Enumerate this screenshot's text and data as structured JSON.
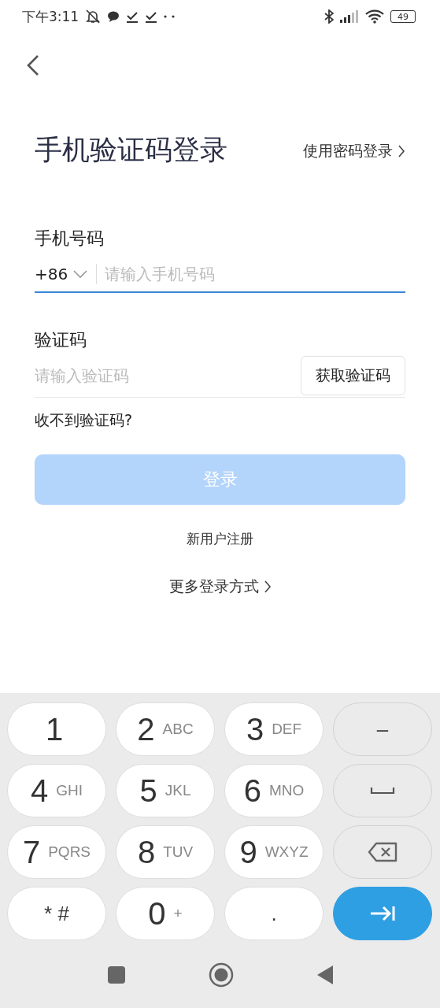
{
  "status_bar": {
    "time": "下午3:11",
    "battery": "49"
  },
  "header": {
    "title": "手机验证码登录",
    "switch_link": "使用密码登录"
  },
  "phone": {
    "label": "手机号码",
    "country_code": "+86",
    "placeholder": "请输入手机号码",
    "focused": true
  },
  "code": {
    "label": "验证码",
    "placeholder": "请输入验证码",
    "get_code_button": "获取验证码"
  },
  "help_link": "收不到验证码?",
  "login_button": {
    "label": "登录",
    "disabled": true
  },
  "register_link": "新用户注册",
  "more_link": "更多登录方式",
  "keyboard": {
    "keys": [
      {
        "kind": "digit",
        "main": "1"
      },
      {
        "kind": "digit",
        "main": "2",
        "letters": "ABC"
      },
      {
        "kind": "digit",
        "main": "3",
        "letters": "DEF"
      },
      {
        "kind": "text",
        "main": "–"
      },
      {
        "kind": "digit",
        "main": "4",
        "letters": "GHI"
      },
      {
        "kind": "digit",
        "main": "5",
        "letters": "JKL"
      },
      {
        "kind": "digit",
        "main": "6",
        "letters": "MNO"
      },
      {
        "kind": "space"
      },
      {
        "kind": "digit",
        "main": "7",
        "letters": "PQRS"
      },
      {
        "kind": "digit",
        "main": "8",
        "letters": "TUV"
      },
      {
        "kind": "digit",
        "main": "9",
        "letters": "WXYZ"
      },
      {
        "kind": "backspace"
      },
      {
        "kind": "symbol",
        "main": "* #"
      },
      {
        "kind": "digit",
        "main": "0",
        "letters": "+"
      },
      {
        "kind": "symbol",
        "main": "."
      },
      {
        "kind": "enter"
      }
    ]
  }
}
